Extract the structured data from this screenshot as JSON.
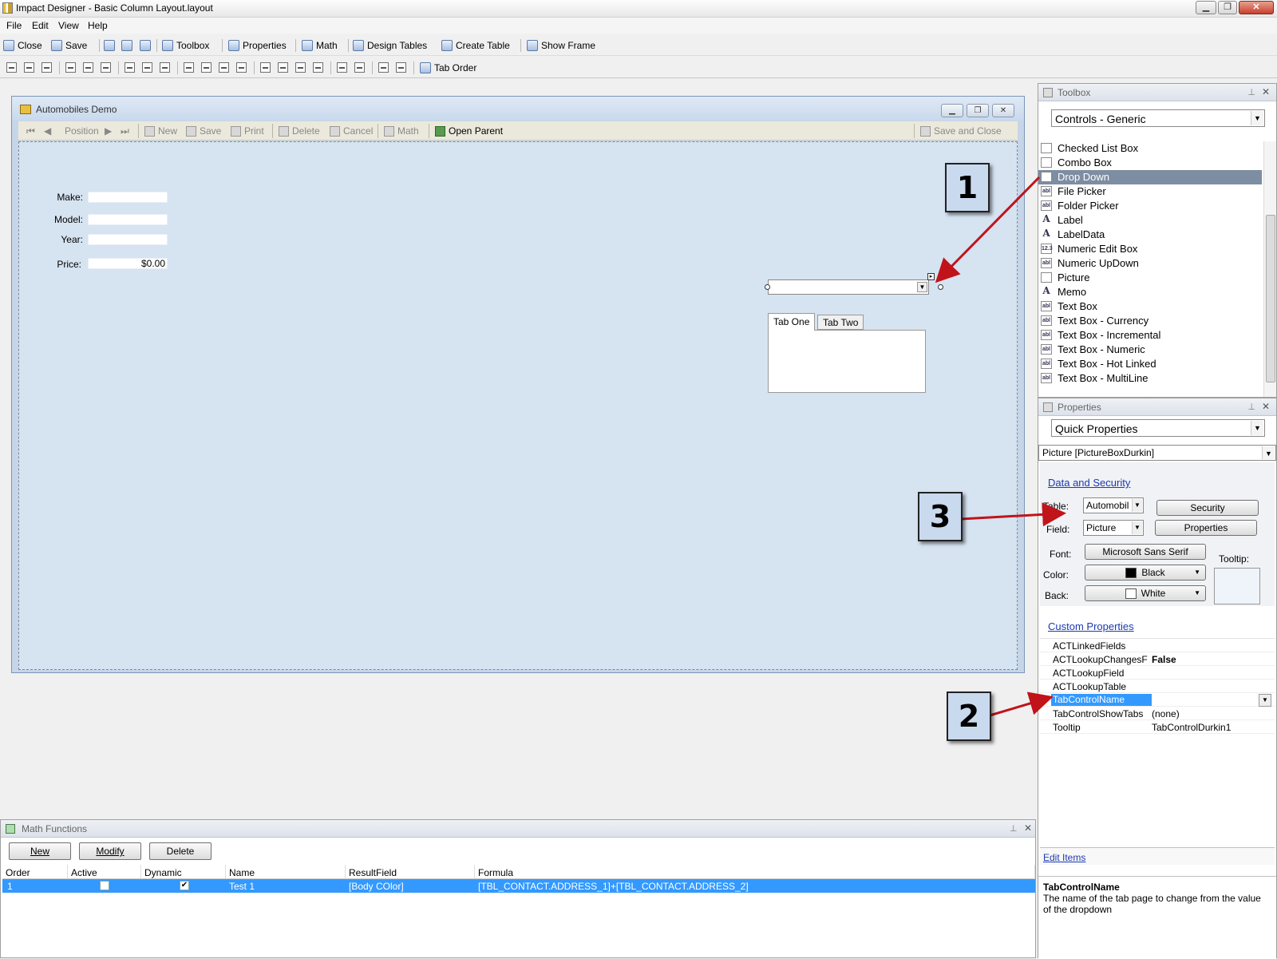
{
  "window": {
    "title": "Impact Designer - Basic Column Layout.layout",
    "min": "▁",
    "max": "❐",
    "close": "✕"
  },
  "menu": [
    "File",
    "Edit",
    "View",
    "Help"
  ],
  "toolbar1": [
    "Close",
    "Save",
    "Toolbox",
    "Properties",
    "Math",
    "Design Tables",
    "Create Table",
    "Show Frame"
  ],
  "toolbar2": {
    "tab_order": "Tab Order"
  },
  "form": {
    "title": "Automobiles Demo",
    "toolbar": {
      "position": "Position",
      "new": "New",
      "save": "Save",
      "print": "Print",
      "delete": "Delete",
      "cancel": "Cancel",
      "math": "Math",
      "open_parent": "Open Parent",
      "save_close": "Save and Close"
    },
    "fields": [
      {
        "label": "Make:",
        "value": ""
      },
      {
        "label": "Model:",
        "value": ""
      },
      {
        "label": "Year:",
        "value": ""
      },
      {
        "label": "Price:",
        "value": "$0.00"
      }
    ],
    "tabs": [
      "Tab One",
      "Tab Two"
    ]
  },
  "toolbox": {
    "title": "Toolbox",
    "category": "Controls - Generic",
    "selected": "Drop Down",
    "items": [
      {
        "label": "Checked List Box",
        "icon": "list-icon"
      },
      {
        "label": "Combo Box",
        "icon": "list-icon"
      },
      {
        "label": "Drop Down",
        "icon": "list-icon"
      },
      {
        "label": "File Picker",
        "icon": "abl"
      },
      {
        "label": "Folder Picker",
        "icon": "abl"
      },
      {
        "label": "Label",
        "icon": "A"
      },
      {
        "label": "LabelData",
        "icon": "A"
      },
      {
        "label": "Numeric Edit Box",
        "icon": "12.3"
      },
      {
        "label": "Numeric UpDown",
        "icon": "abl"
      },
      {
        "label": "Picture",
        "icon": "picture-icon"
      },
      {
        "label": "Memo",
        "icon": "A"
      },
      {
        "label": "Text Box",
        "icon": "abl"
      },
      {
        "label": "Text Box - Currency",
        "icon": "abl"
      },
      {
        "label": "Text Box - Incremental",
        "icon": "abl"
      },
      {
        "label": "Text Box - Numeric",
        "icon": "abl"
      },
      {
        "label": "Text Box - Hot Linked",
        "icon": "abl"
      },
      {
        "label": "Text Box - MultiLine",
        "icon": "abl"
      }
    ]
  },
  "properties": {
    "title": "Properties",
    "mode": "Quick Properties",
    "object": "Picture [PictureBoxDurkin]",
    "data_security": "Data and Security",
    "table_label": "Table:",
    "table_value": "Automobil",
    "field_label": "Field:",
    "field_value": "Picture",
    "font_label": "Font:",
    "font_value": "Microsoft Sans Serif",
    "color_label": "Color:",
    "color_value": "Black",
    "back_label": "Back:",
    "back_value": "White",
    "tooltip_label": "Tooltip:",
    "security_btn": "Security",
    "properties_btn": "Properties",
    "custom_link": "Custom Properties",
    "custom": [
      {
        "key": "ACTLinkedFields",
        "value": ""
      },
      {
        "key": "ACTLookupChangesF",
        "value": "False"
      },
      {
        "key": "ACTLookupField",
        "value": ""
      },
      {
        "key": "ACTLookupTable",
        "value": ""
      },
      {
        "key": "TabControlName",
        "value": ""
      },
      {
        "key": "TabControlShowTabs",
        "value": "(none)"
      },
      {
        "key": "Tooltip",
        "value": "TabControlDurkin1"
      }
    ],
    "edit_items": "Edit Items",
    "desc_title": "TabControlName",
    "desc_text": "The name of the tab page to change from the value of the dropdown"
  },
  "math": {
    "title": "Math Functions",
    "buttons": [
      "New",
      "Modify",
      "Delete"
    ],
    "columns": [
      "Order",
      "Active",
      "Dynamic",
      "Name",
      "ResultField",
      "Formula"
    ],
    "rows": [
      {
        "order": "1",
        "active": false,
        "dynamic": true,
        "name": "Test 1",
        "result": "[Body COlor]",
        "formula": "[TBL_CONTACT.ADDRESS_1]+[TBL_CONTACT.ADDRESS_2]"
      }
    ]
  },
  "callouts": [
    "1",
    "2",
    "3"
  ],
  "colors": {
    "accent": "#3399ff",
    "arrow": "#c0141a",
    "canvas": "#d6e3f1"
  }
}
